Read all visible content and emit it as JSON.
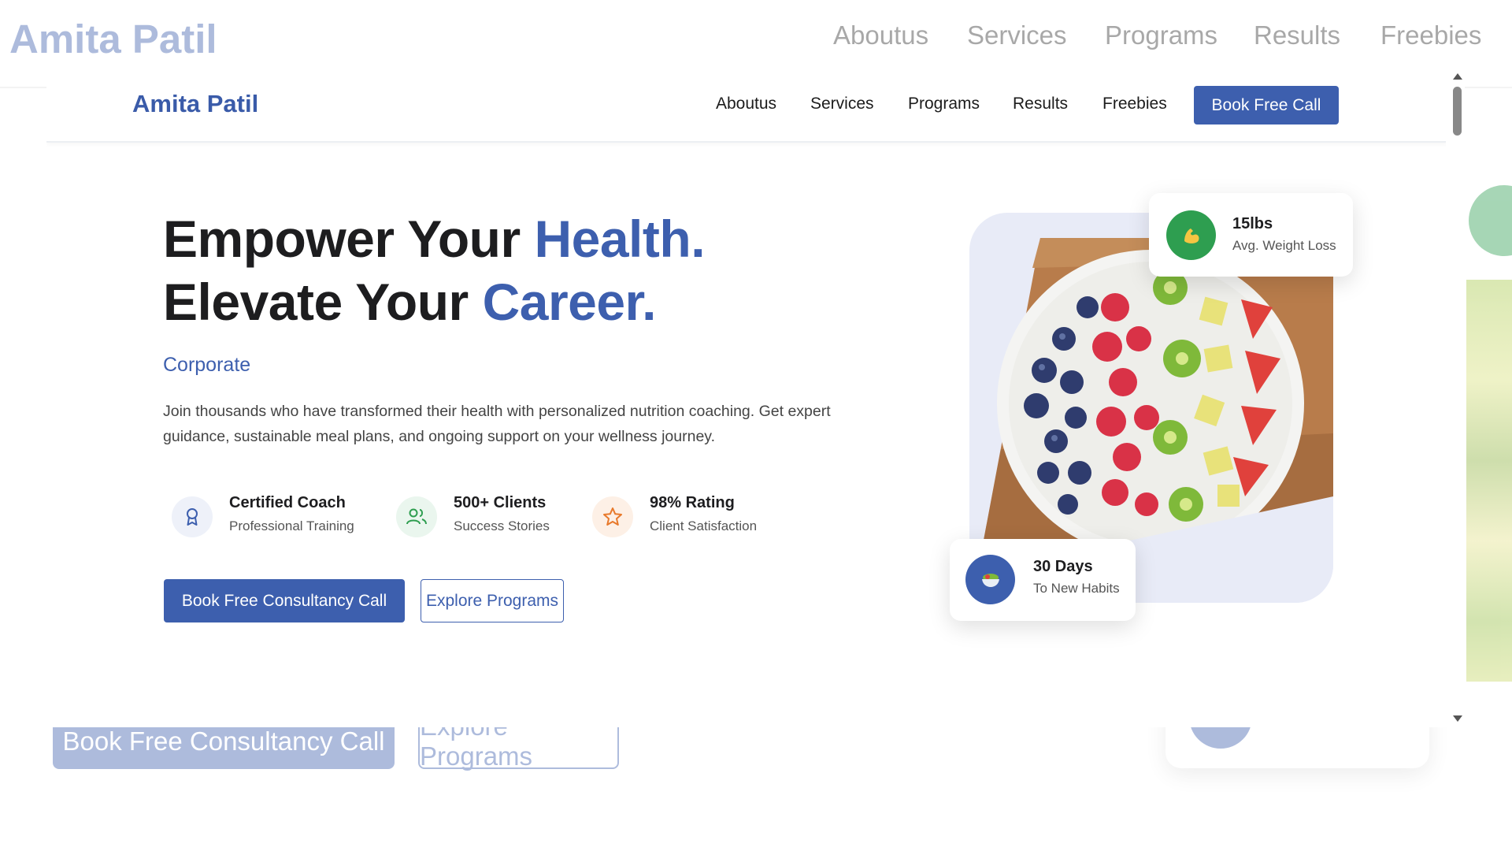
{
  "site": {
    "brand": "Amita Patil",
    "nav": [
      "Aboutus",
      "Services",
      "Programs",
      "Results",
      "Freebies"
    ],
    "cta": "Book Free Call"
  },
  "hero": {
    "title_line1_prefix": "Empower Your ",
    "title_line1_accent": "Health.",
    "title_line2_prefix": "Elevate Your ",
    "title_line2_accent": "Career.",
    "tagline": "Corporate",
    "description": "Join thousands who have transformed their health with personalized nutrition coaching. Get expert guidance, sustainable meal plans, and ongoing support on your wellness journey.",
    "stats": [
      {
        "title": "Certified Coach",
        "subtitle": "Professional Training",
        "icon": "award-icon",
        "color": "#3d5fae"
      },
      {
        "title": "500+ Clients",
        "subtitle": "Success Stories",
        "icon": "users-icon",
        "color": "#2e9e50"
      },
      {
        "title": "98% Rating",
        "subtitle": "Client Satisfaction",
        "icon": "star-icon",
        "color": "#e8792b"
      }
    ],
    "primary_button": "Book Free Consultancy Call",
    "secondary_button": "Explore Programs"
  },
  "cards": {
    "weight": {
      "title": "15lbs",
      "subtitle": "Avg. Weight Loss",
      "icon": "flexed-biceps-icon",
      "color": "#2e9e50"
    },
    "habits": {
      "title": "30 Days",
      "subtitle": "To New Habits",
      "icon": "salad-bowl-icon",
      "color": "#3d5fae"
    }
  },
  "background": {
    "primary_button": "Book Free Consultancy Call",
    "secondary_button": "Explore Programs",
    "card_subtitle": "To New Habits"
  },
  "colors": {
    "accent": "#3d5fae",
    "green": "#2e9e50",
    "orange": "#e8792b"
  }
}
